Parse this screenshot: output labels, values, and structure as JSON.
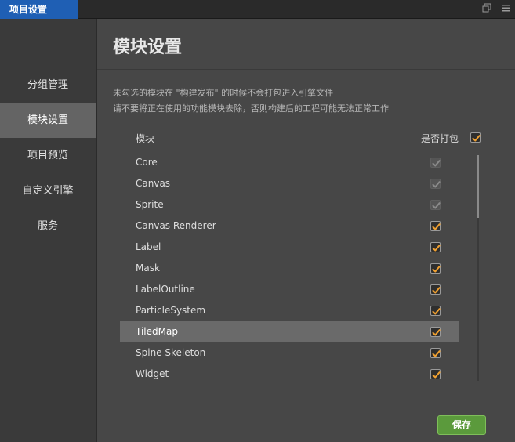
{
  "window": {
    "tab_title": "项目设置",
    "icons": [
      "restore-icon",
      "menu-icon"
    ]
  },
  "sidebar": {
    "items": [
      {
        "label": "分组管理",
        "active": false
      },
      {
        "label": "模块设置",
        "active": true
      },
      {
        "label": "项目预览",
        "active": false
      },
      {
        "label": "自定义引擎",
        "active": false
      },
      {
        "label": "服务",
        "active": false
      }
    ]
  },
  "main": {
    "title": "模块设置",
    "description_line1": "未勾选的模块在 \"构建发布\" 的时候不会打包进入引擎文件",
    "description_line2": "请不要将正在使用的功能模块去除，否则构建后的工程可能无法正常工作",
    "column_module": "模块",
    "column_include": "是否打包",
    "header_checked": true,
    "modules": [
      {
        "name": "Core",
        "checked": true,
        "disabled": true,
        "selected": false
      },
      {
        "name": "Canvas",
        "checked": true,
        "disabled": true,
        "selected": false
      },
      {
        "name": "Sprite",
        "checked": true,
        "disabled": true,
        "selected": false
      },
      {
        "name": "Canvas Renderer",
        "checked": true,
        "disabled": false,
        "selected": false
      },
      {
        "name": "Label",
        "checked": true,
        "disabled": false,
        "selected": false
      },
      {
        "name": "Mask",
        "checked": true,
        "disabled": false,
        "selected": false
      },
      {
        "name": "LabelOutline",
        "checked": true,
        "disabled": false,
        "selected": false
      },
      {
        "name": "ParticleSystem",
        "checked": true,
        "disabled": false,
        "selected": false
      },
      {
        "name": "TiledMap",
        "checked": true,
        "disabled": false,
        "selected": true
      },
      {
        "name": "Spine Skeleton",
        "checked": true,
        "disabled": false,
        "selected": false
      },
      {
        "name": "Widget",
        "checked": true,
        "disabled": false,
        "selected": false
      }
    ],
    "save_label": "保存"
  },
  "colors": {
    "accent_tab": "#1f5fb4",
    "checkmark": "#f0a030",
    "checkmark_disabled": "#8a8a8a",
    "save_button": "#5b9a3c"
  }
}
